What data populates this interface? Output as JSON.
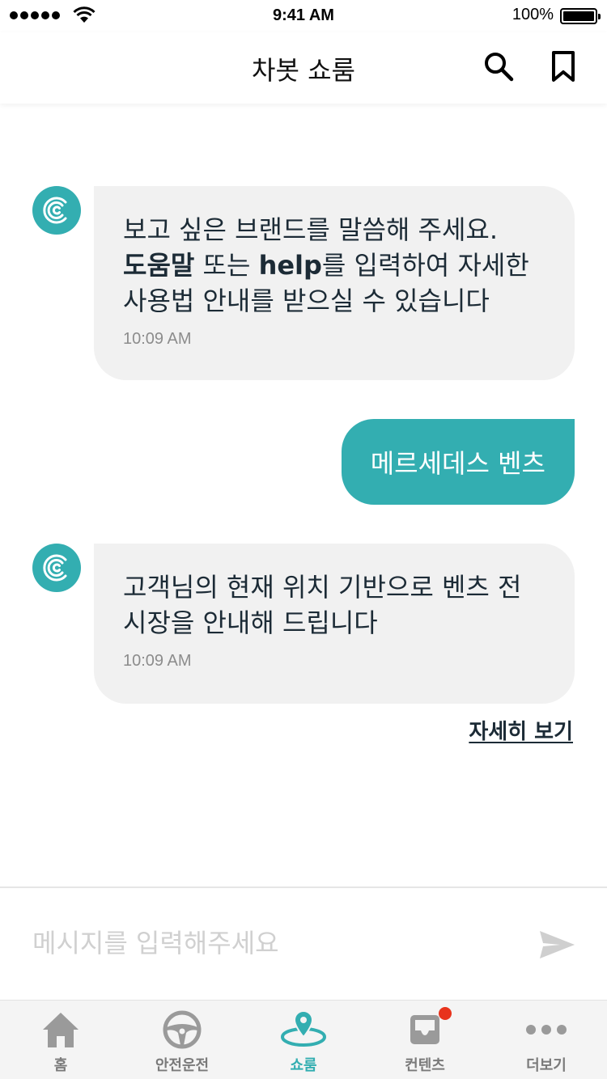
{
  "status_bar": {
    "time": "9:41 AM",
    "battery": "100%"
  },
  "header": {
    "title": "차봇 쇼룸"
  },
  "messages": [
    {
      "line1": "보고 싶은 브랜드를 말씀해 주세요.",
      "bold1": "도움말",
      "mid1": " 또는 ",
      "bold2": "help",
      "mid2": "를 입력하여 자세한",
      "line3": "사용법 안내를 받으실 수 있습니다",
      "time": "10:09 AM"
    },
    {
      "text": "메르세데스 벤츠"
    },
    {
      "line1": "고객님의 현재 위치 기반으로 벤츠 전",
      "line2": "시장을 안내해 드립니다",
      "time": "10:09 AM",
      "link": "자세히 보기"
    }
  ],
  "input": {
    "placeholder": "메시지를 입력해주세요"
  },
  "tabs": [
    {
      "label": "홈"
    },
    {
      "label": "안전운전"
    },
    {
      "label": "쇼룸"
    },
    {
      "label": "컨텐츠"
    },
    {
      "label": "더보기"
    }
  ],
  "colors": {
    "accent": "#33aeb1",
    "bubble": "#f1f1f1",
    "badge": "#e8331c",
    "inactive": "#7a7a7a"
  },
  "icons": [
    "search-icon",
    "bookmark-icon",
    "chatbot-icon",
    "send-icon",
    "home-icon",
    "steering-wheel-icon",
    "location-pin-icon",
    "inbox-icon",
    "more-icon"
  ]
}
